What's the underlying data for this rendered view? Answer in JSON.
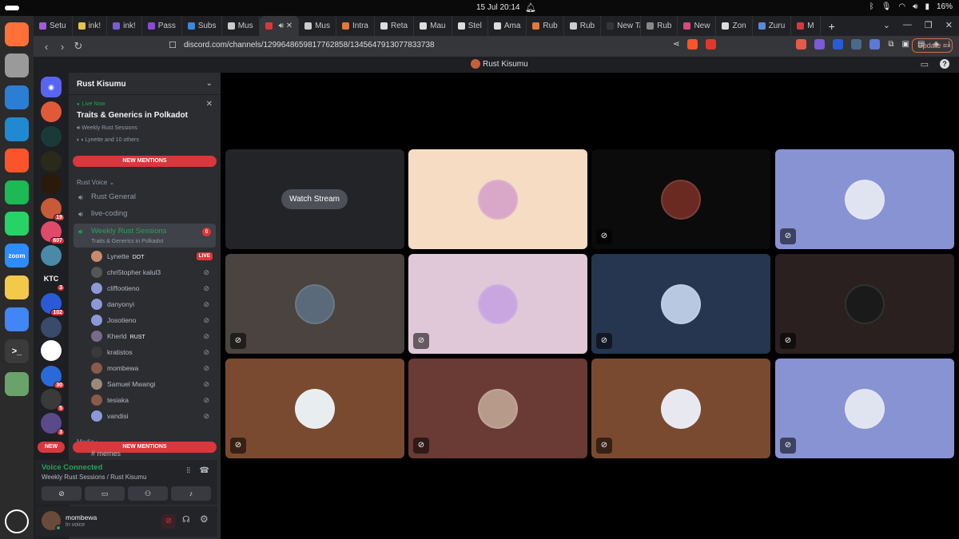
{
  "os": {
    "clock": "15 Jul  20:14",
    "battery": "16%"
  },
  "dock": [
    {
      "name": "firefox-icon",
      "color": "#ff7139",
      "glyph": "",
      "badge": ""
    },
    {
      "name": "files-icon",
      "color": "#9a9a9a",
      "glyph": "",
      "badge": ""
    },
    {
      "name": "writer-icon",
      "color": "#2a7fd4",
      "glyph": "",
      "badge": ""
    },
    {
      "name": "vscode-icon",
      "color": "#1f8ad2",
      "glyph": "",
      "badge": ""
    },
    {
      "name": "brave-icon",
      "color": "#fb542b",
      "glyph": "",
      "badge": ""
    },
    {
      "name": "spotify-icon",
      "color": "#1db954",
      "glyph": "",
      "badge": "1"
    },
    {
      "name": "whatsapp-icon",
      "color": "#25d366",
      "glyph": "",
      "badge": ""
    },
    {
      "name": "zoom-icon",
      "color": "#2d8cff",
      "glyph": "zoom",
      "badge": ""
    },
    {
      "name": "text-editor-icon",
      "color": "#f3c94a",
      "glyph": "",
      "badge": ""
    },
    {
      "name": "chrome-icon",
      "color": "#4285f4",
      "glyph": "",
      "badge": ""
    },
    {
      "name": "terminal-icon",
      "color": "#3b3b3b",
      "glyph": ">_",
      "badge": ""
    },
    {
      "name": "trash-icon",
      "color": "#6aa36a",
      "glyph": "",
      "badge": ""
    }
  ],
  "tabs": [
    {
      "label": "Setu",
      "color": "#a35bd8"
    },
    {
      "label": "ink!",
      "color": "#e6c34a"
    },
    {
      "label": "ink!",
      "color": "#7a5bd8"
    },
    {
      "label": "Pass",
      "color": "#8a4ad8"
    },
    {
      "label": "Subs",
      "color": "#3a8ad8"
    },
    {
      "label": "Mus",
      "color": "#cccccc"
    },
    {
      "label": "",
      "color": "#da373c"
    },
    {
      "label": "Mus",
      "color": "#cccccc"
    },
    {
      "label": "Intra",
      "color": "#e07a3a"
    },
    {
      "label": "Reta",
      "color": "#dddddd"
    },
    {
      "label": "Mau",
      "color": "#dddddd"
    },
    {
      "label": "Stel",
      "color": "#dddddd"
    },
    {
      "label": "Ama",
      "color": "#dddddd"
    },
    {
      "label": "Rub",
      "color": "#e07a3a"
    },
    {
      "label": "Rub",
      "color": "#cccccc"
    },
    {
      "label": "New Ta",
      "color": "#35363a"
    },
    {
      "label": "Rub",
      "color": "#888888"
    },
    {
      "label": "New",
      "color": "#d84a7a"
    },
    {
      "label": "Zon",
      "color": "#dddddd"
    },
    {
      "label": "Zuru",
      "color": "#5a8ad8"
    },
    {
      "label": "M",
      "color": "#da373c"
    }
  ],
  "address": {
    "url": "discord.com/channels/1299648659817762858/1345647913077833738",
    "update_label": "Update"
  },
  "discord": {
    "window_title": "Rust Kisumu",
    "server_name": "Rust Kisumu",
    "live_card": {
      "badge": "Live Now",
      "title": "Traits & Generics in Polkadot",
      "channel": "Weekly Rust Sessions",
      "attendees": "Lynette and 10 others"
    },
    "new_mentions": "NEW MENTIONS",
    "new_label": "NEW",
    "category_voice": "Rust Voice",
    "category_media": "Media",
    "media_channel": "memes",
    "channels": [
      {
        "name": "Rust General"
      },
      {
        "name": "live-coding"
      }
    ],
    "selected_channel": {
      "name": "Weekly Rust Sessions",
      "topic": "Traits & Generics in Polkadot",
      "count": "6"
    },
    "members": [
      {
        "name": "Lynette",
        "tag": "DOT",
        "live": "LIVE",
        "color": "#c98a6a"
      },
      {
        "name": "chri5topher kalul3",
        "tag": "",
        "live": "",
        "color": "#555555"
      },
      {
        "name": "cliffootieno",
        "tag": "",
        "live": "",
        "color": "#8a9ad8"
      },
      {
        "name": "danyonyi",
        "tag": "",
        "live": "",
        "color": "#8a9ad8"
      },
      {
        "name": "Josotieno",
        "tag": "",
        "live": "",
        "color": "#8a9ad8"
      },
      {
        "name": "Kherld",
        "tag": "RUST",
        "live": "",
        "color": "#7a6a8a"
      },
      {
        "name": "kratistos",
        "tag": "",
        "live": "",
        "color": "#3a3a3a"
      },
      {
        "name": "mombewa",
        "tag": "",
        "live": "",
        "color": "#8a5a4a"
      },
      {
        "name": "Samuel Mwangi",
        "tag": "",
        "live": "",
        "color": "#9a8a7a"
      },
      {
        "name": "tesiaka",
        "tag": "",
        "live": "",
        "color": "#8a5a4a"
      },
      {
        "name": "vandisi",
        "tag": "",
        "live": "",
        "color": "#8a9ad8"
      }
    ],
    "voice": {
      "status": "Voice Connected",
      "location": "Weekly Rust Sessions / Rust Kisumu"
    },
    "user": {
      "name": "mombewa",
      "status": "In voice"
    },
    "watch_label": "Watch Stream",
    "server_badges": [
      "19",
      "607",
      "3",
      "102",
      "30",
      "5",
      "3"
    ]
  },
  "tiles": [
    {
      "bg": "#232428",
      "avatar": "",
      "stream": true,
      "muted": false
    },
    {
      "bg": "#f5dcc2",
      "avatar": "#d9a8c8",
      "stream": false,
      "muted": false
    },
    {
      "bg": "#0c0b0b",
      "avatar": "#6a2a22",
      "stream": false,
      "muted": true
    },
    {
      "bg": "#8893d4",
      "avatar": "#dfe4f0",
      "stream": false,
      "muted": true
    },
    {
      "bg": "#4a433f",
      "avatar": "#5a6a7a",
      "stream": false,
      "muted": true
    },
    {
      "bg": "#e0c8d8",
      "avatar": "#caa6e0",
      "stream": false,
      "muted": true
    },
    {
      "bg": "#263650",
      "avatar": "#b8c8e0",
      "stream": false,
      "muted": true
    },
    {
      "bg": "#2a2020",
      "avatar": "#1a1a1a",
      "stream": false,
      "muted": true
    },
    {
      "bg": "#7a4a30",
      "avatar": "#e8eef0",
      "stream": false,
      "muted": true
    },
    {
      "bg": "#6a3a34",
      "avatar": "#b89a8a",
      "stream": false,
      "muted": true
    },
    {
      "bg": "#7a4a30",
      "avatar": "#e8e8f0",
      "stream": false,
      "muted": true
    },
    {
      "bg": "#8893d4",
      "avatar": "#dfe4f0",
      "stream": false,
      "muted": true
    }
  ]
}
